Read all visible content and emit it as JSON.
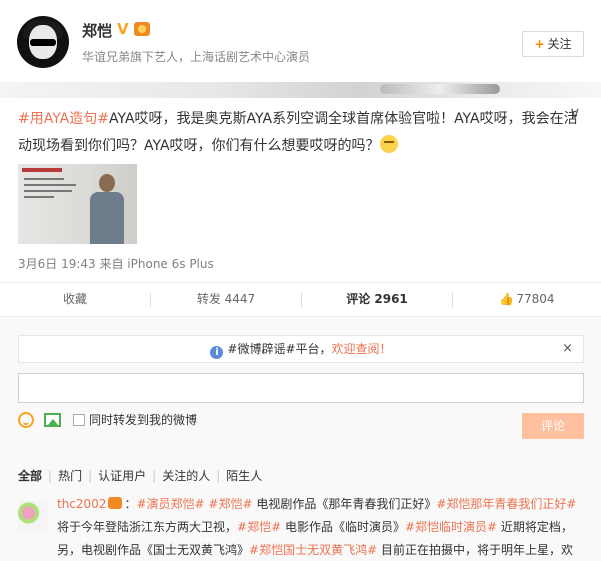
{
  "profile": {
    "name": "郑恺",
    "badge": "V",
    "verify": "华谊兄弟旗下艺人，上海话剧艺术中心演员",
    "follow_label": "关注",
    "follow_plus": "+"
  },
  "post": {
    "collapse_icon": "∨",
    "segments": [
      {
        "text": "#用AYA造句#",
        "type": "hashtag"
      },
      {
        "text": "AYA哎呀，我是奥克斯AYA系列空调全球首席体验官啦！AYA哎呀，我会在活动现场看到你们吗？AYA哎呀，你们有什么想要哎呀的吗？",
        "type": "text"
      }
    ],
    "meta": "3月6日 19:43 来自 iPhone 6s Plus"
  },
  "actions": {
    "favorite": "收藏",
    "repost": "转发 4447",
    "comment": "评论 2961",
    "like": "77804"
  },
  "comments": {
    "notice_prefix": "#微博辟谣#平台，",
    "notice_link": "欢迎查阅！",
    "notice_close": "×",
    "input_value": "",
    "repost_check_label": "同时转发到我的微博",
    "submit_label": "评论",
    "tabs": [
      "全部",
      "热门",
      "认证用户",
      "关注的人",
      "陌生人"
    ],
    "first": {
      "user": "thc2002",
      "segments": [
        {
          "text": "#演员郑恺#",
          "type": "hashtag"
        },
        {
          "text": " ",
          "type": "text"
        },
        {
          "text": "#郑恺#",
          "type": "hashtag"
        },
        {
          "text": " 电视剧作品《那年青春我们正好》",
          "type": "text"
        },
        {
          "text": "#郑恺那年青春我们正好#",
          "type": "hashtag"
        },
        {
          "text": " 将于今年登陆浙江东方两大卫视，",
          "type": "text"
        },
        {
          "text": "#郑恺#",
          "type": "hashtag"
        },
        {
          "text": " 电影作品《临时演员》",
          "type": "text"
        },
        {
          "text": "#郑恺临时演员#",
          "type": "hashtag"
        },
        {
          "text": " 近期将定档，另，电视剧作品《国士无双黄飞鸿》",
          "type": "text"
        },
        {
          "text": "#郑恺国士无双黄飞鸿#",
          "type": "hashtag"
        },
        {
          "text": " 目前正在拍摄中，将于明年上星，欢迎大家关注",
          "type": "text"
        }
      ]
    }
  }
}
